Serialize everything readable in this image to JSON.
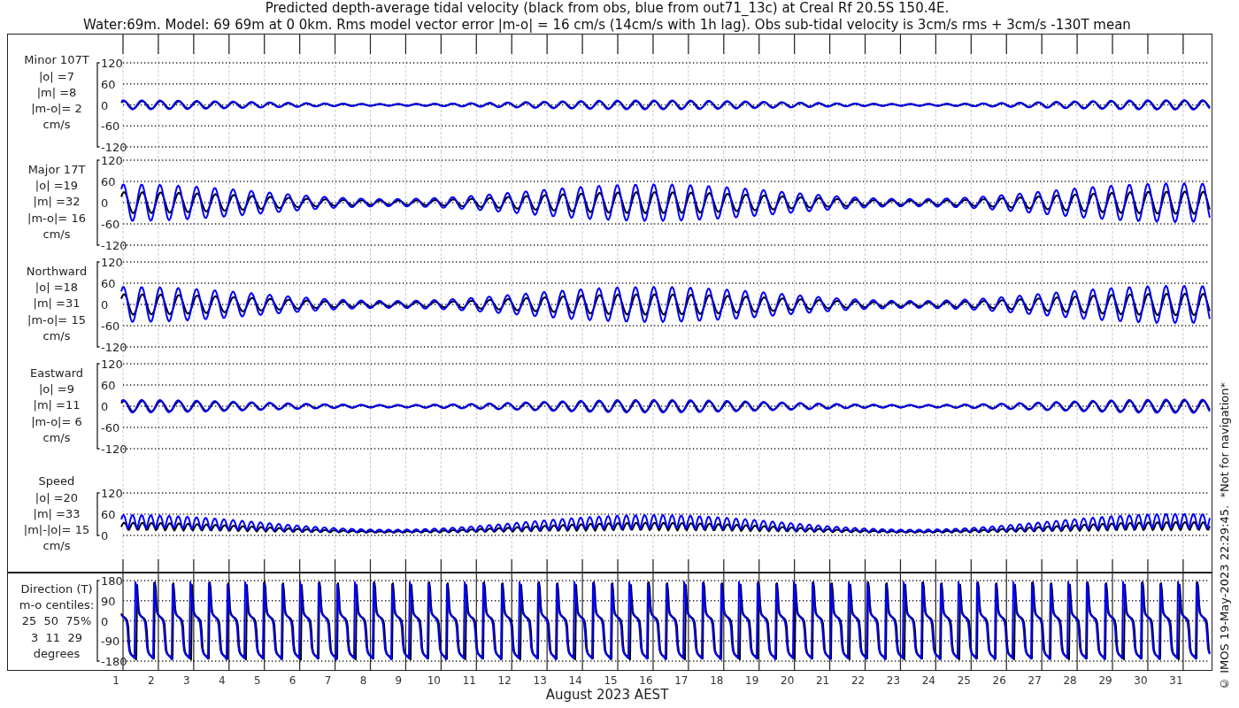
{
  "title_lines": [
    "Predicted depth-average tidal velocity (black from obs, blue from out71_13c) at Creal Rf 20.5S 150.4E.",
    "Water:69m. Model: 69 69m at 0 0km. Rms model vector error |m-o| = 16 cm/s (14cm/s with 1h lag). Obs sub-tidal velocity is 3cm/s rms + 3cm/s -130T mean"
  ],
  "panels": [
    {
      "kind": "velocity",
      "label_lines": [
        "Minor 107T",
        "|o| =7",
        "|m| =8",
        "|m-o|= 2",
        "cm/s"
      ],
      "y_tick_labels": [
        "120",
        "60",
        "0",
        "-60",
        "-120"
      ]
    },
    {
      "kind": "velocity",
      "label_lines": [
        "Major 17T",
        "|o| =19",
        "|m| =32",
        "|m-o|= 16",
        "cm/s"
      ],
      "y_tick_labels": [
        "120",
        "60",
        "0",
        "-60",
        "-120"
      ]
    },
    {
      "kind": "velocity",
      "label_lines": [
        "Northward",
        "|o| =18",
        "|m| =31",
        "|m-o|= 15",
        "cm/s"
      ],
      "y_tick_labels": [
        "120",
        "60",
        "0",
        "-60",
        "-120"
      ]
    },
    {
      "kind": "velocity",
      "label_lines": [
        "Eastward",
        "|o| =9",
        "|m| =11",
        "|m-o|= 6",
        "cm/s"
      ],
      "y_tick_labels": [
        "120",
        "60",
        "0",
        "-60",
        "-120"
      ]
    },
    {
      "kind": "speed",
      "label_lines": [
        "Speed",
        "|o| =20",
        "|m| =33",
        "|m|-|o|= 15",
        "cm/s"
      ],
      "y_tick_labels": [
        "120",
        "60",
        "0"
      ]
    },
    {
      "kind": "direction",
      "label_lines": [
        "Direction (T)",
        "m-o centiles:",
        "25  50  75%",
        "3  11  29",
        "degrees"
      ],
      "y_tick_labels": [
        "180",
        "90",
        "0",
        "-90",
        "-180"
      ]
    }
  ],
  "day_labels": [
    "1",
    "2",
    "3",
    "4",
    "5",
    "6",
    "7",
    "8",
    "9",
    "10",
    "11",
    "12",
    "13",
    "14",
    "15",
    "16",
    "17",
    "18",
    "19",
    "20",
    "21",
    "22",
    "23",
    "24",
    "25",
    "26",
    "27",
    "28",
    "29",
    "30",
    "31"
  ],
  "x_axis_title": "August 2023 AEST",
  "credit": "© IMOS 19-May-2023 22:29:45.  *Not for navigation*"
}
